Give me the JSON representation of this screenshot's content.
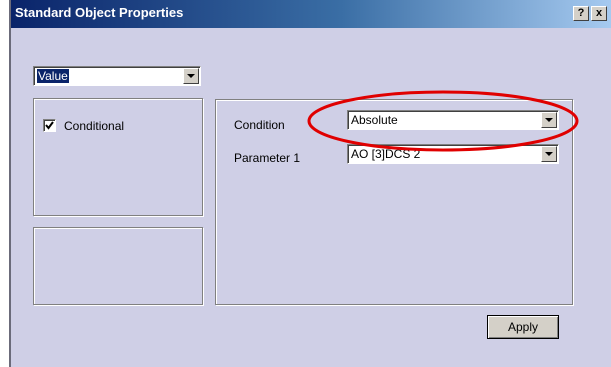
{
  "window": {
    "title": "Standard Object Properties",
    "help_label": "?",
    "close_label": "x"
  },
  "type_combo": {
    "value": "Value"
  },
  "conditional": {
    "label": "Conditional",
    "checked": true
  },
  "condition": {
    "label": "Condition",
    "value": "Absolute"
  },
  "parameter1": {
    "label": "Parameter 1",
    "value": "AO [3]DCS 2"
  },
  "apply_label": "Apply",
  "colors": {
    "highlight_ellipse": "#e00000",
    "dialog_bg": "#cfcfe6",
    "title_bar": "#0a246a"
  }
}
